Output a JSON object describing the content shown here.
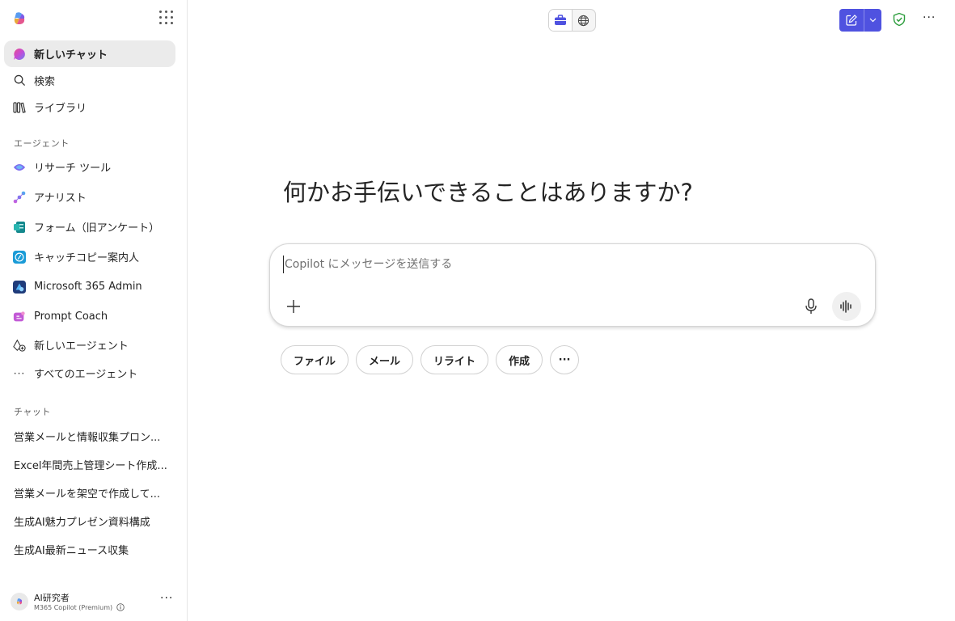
{
  "sidebar": {
    "new_chat": "新しいチャット",
    "search": "検索",
    "library": "ライブラリ",
    "agents_label": "エージェント",
    "agents": [
      {
        "label": "リサーチ ツール",
        "icon": "research-tool-icon"
      },
      {
        "label": "アナリスト",
        "icon": "analyst-icon"
      },
      {
        "label": "フォーム（旧アンケート）",
        "icon": "forms-icon"
      },
      {
        "label": "キャッチコピー案内人",
        "icon": "catchcopy-agent-icon"
      },
      {
        "label": "Microsoft 365 Admin",
        "icon": "m365-admin-icon"
      },
      {
        "label": "Prompt Coach",
        "icon": "prompt-coach-icon"
      }
    ],
    "new_agent": "新しいエージェント",
    "all_agents": "すべてのエージェント",
    "chats_label": "チャット",
    "chats": [
      "営業メールと情報収集プロン...",
      "Excel年間売上管理シート作成...",
      "営業メールを架空で作成して...",
      "生成AI魅力プレゼン資料構成",
      "生成AI最新ニュース収集"
    ],
    "profile": {
      "name": "AI研究者",
      "plan": "M365 Copilot (Premium)"
    }
  },
  "main": {
    "greeting": "何かお手伝いできることはありますか?",
    "composer_placeholder": "Copilot にメッセージを送信する",
    "chips": [
      "ファイル",
      "メール",
      "リライト",
      "作成"
    ]
  },
  "colors": {
    "accent": "#4f52e0",
    "shield": "#2e9e3e"
  }
}
